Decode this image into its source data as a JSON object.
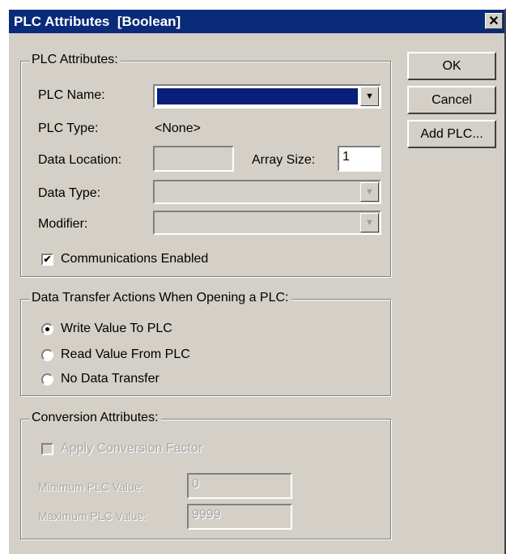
{
  "window": {
    "title": "PLC Attributes  [Boolean]",
    "close_label": "✕"
  },
  "buttons": {
    "ok": "OK",
    "cancel": "Cancel",
    "add_plc": "Add PLC..."
  },
  "plc_attributes": {
    "legend": "PLC Attributes:",
    "plc_name_label": "PLC Name:",
    "plc_type_label": "PLC Type:",
    "plc_type_value": "<None>",
    "data_location_label": "Data Location:",
    "array_size_label": "Array Size:",
    "array_size_value": "1",
    "data_type_label": "Data Type:",
    "modifier_label": "Modifier:",
    "comm_enabled_label": "Communications Enabled",
    "comm_enabled_checked": true
  },
  "transfer": {
    "legend": "Data Transfer Actions When Opening a PLC:",
    "options": [
      "Write Value To PLC",
      "Read Value From PLC",
      "No Data Transfer"
    ],
    "selected": "Write Value To PLC"
  },
  "conversion": {
    "legend": "Conversion Attributes:",
    "apply_label": "Apply Conversion Factor",
    "min_label": "Minimum PLC Value:",
    "min_value": "0",
    "max_label": "Maximum PLC Value:",
    "max_value": "9999"
  },
  "glyphs": {
    "dropdown_arrow": "▼",
    "check_mark": "✔"
  }
}
